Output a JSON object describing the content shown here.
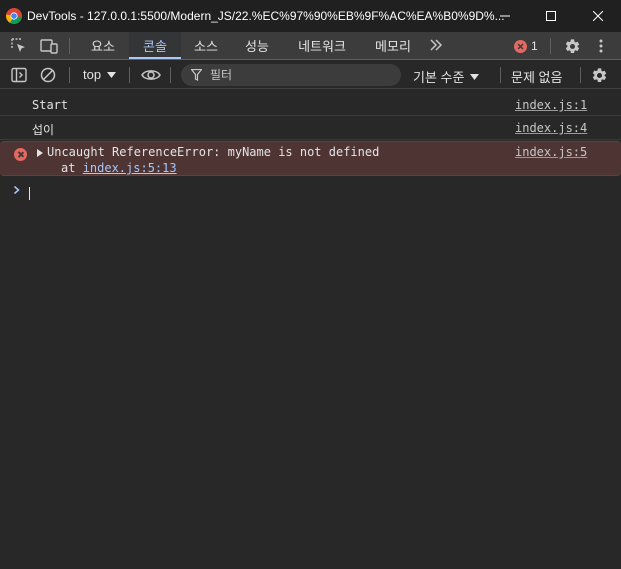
{
  "window": {
    "title": "DevTools - 127.0.0.1:5500/Modern_JS/22.%EC%97%90%EB%9F%AC%EA%B0%9D%..."
  },
  "tabs": [
    {
      "label": "요소"
    },
    {
      "label": "콘솔"
    },
    {
      "label": "소스"
    },
    {
      "label": "성능"
    },
    {
      "label": "네트워크"
    },
    {
      "label": "메모리"
    }
  ],
  "error_count": "1",
  "toolbar": {
    "context": "top",
    "filter_placeholder": "필터",
    "levels": "기본 수준",
    "issues": "문제 없음"
  },
  "console": {
    "messages": [
      {
        "text": "Start",
        "source": "index.js:1"
      },
      {
        "text": "섭이",
        "source": "index.js:4"
      }
    ],
    "error": {
      "text": "Uncaught ReferenceError: myName is not defined",
      "stack_prefix": "at",
      "stack_link": "index.js:5:13",
      "source": "index.js:5"
    }
  },
  "colors": {
    "accent": "#a8c7fa",
    "error": "#e46962",
    "error_bg": "#4e3534"
  }
}
